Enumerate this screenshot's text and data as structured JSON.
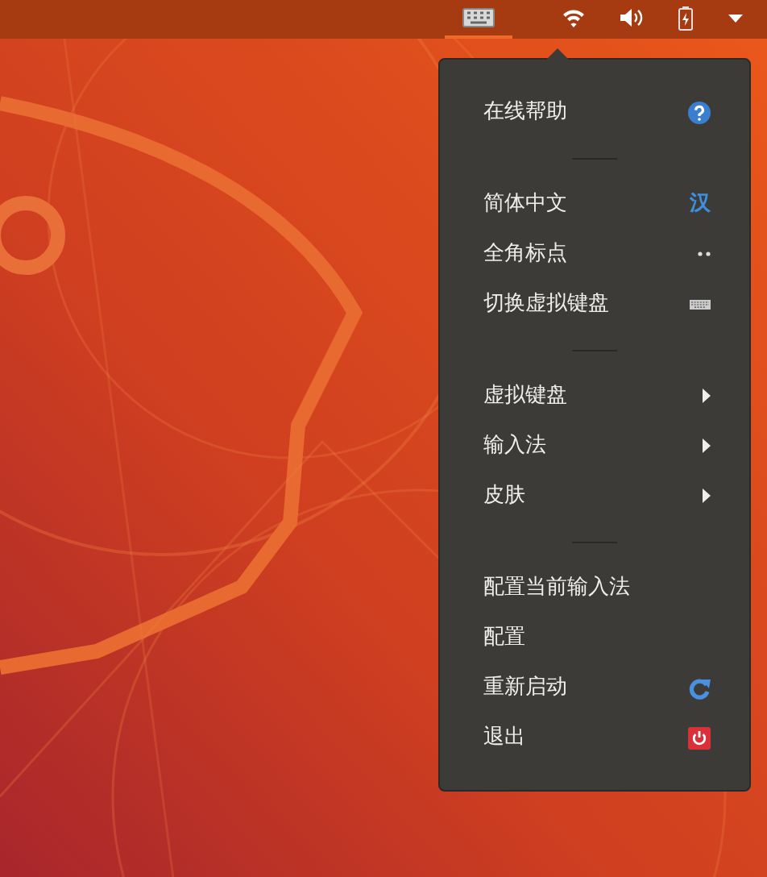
{
  "top_bar": {
    "indicators": [
      {
        "kind": "keyboard",
        "selected": true
      },
      {
        "kind": "wifi",
        "selected": false
      },
      {
        "kind": "volume",
        "selected": false
      },
      {
        "kind": "battery",
        "selected": false
      },
      {
        "kind": "caret",
        "selected": false
      }
    ]
  },
  "menu": {
    "items": [
      {
        "kind": "help",
        "label": "在线帮助"
      },
      {
        "kind": "separator"
      },
      {
        "kind": "language",
        "label": "简体中文",
        "icon_text": "汉"
      },
      {
        "kind": "dots",
        "label": "全角标点"
      },
      {
        "kind": "keyboard",
        "label": "切换虚拟键盘"
      },
      {
        "kind": "separator"
      },
      {
        "kind": "submenu",
        "label": "虚拟键盘"
      },
      {
        "kind": "submenu",
        "label": "输入法"
      },
      {
        "kind": "submenu",
        "label": "皮肤"
      },
      {
        "kind": "separator"
      },
      {
        "kind": "plain",
        "label": "配置当前输入法"
      },
      {
        "kind": "plain",
        "label": "配置"
      },
      {
        "kind": "restart",
        "label": "重新启动"
      },
      {
        "kind": "power",
        "label": "退出"
      }
    ]
  }
}
